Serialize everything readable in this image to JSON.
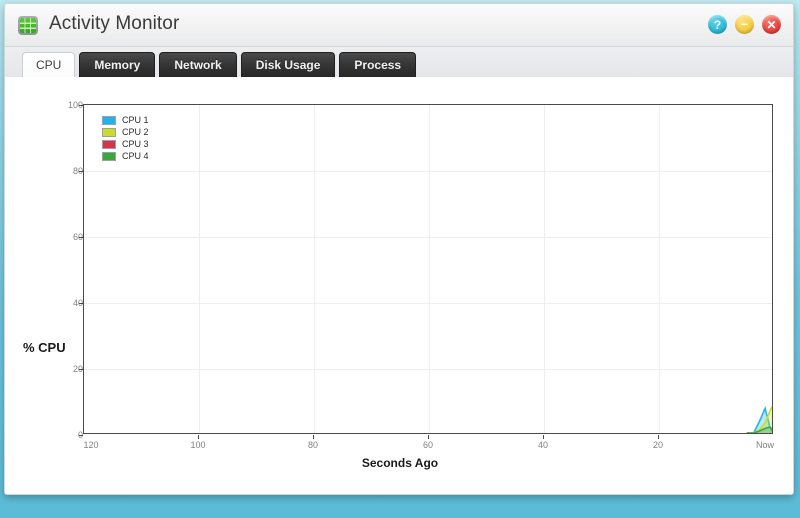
{
  "window": {
    "title": "Activity Monitor",
    "app_icon": "grid-monitor-icon",
    "controls": [
      {
        "name": "help-button",
        "icon": "question-icon",
        "glyph": "?",
        "color": "#2bbcd6"
      },
      {
        "name": "minimize-button",
        "icon": "minus-icon",
        "glyph": "–",
        "color": "#f5cd3e"
      },
      {
        "name": "close-button",
        "icon": "close-icon",
        "glyph": "✕",
        "color": "#e8453c"
      }
    ]
  },
  "tabs": [
    {
      "label": "CPU",
      "active": true
    },
    {
      "label": "Memory",
      "active": false
    },
    {
      "label": "Network",
      "active": false
    },
    {
      "label": "Disk Usage",
      "active": false
    },
    {
      "label": "Process",
      "active": false
    }
  ],
  "chart_data": {
    "type": "line",
    "title": "",
    "xlabel": "Seconds Ago",
    "ylabel": "% CPU",
    "xlim": [
      120,
      0
    ],
    "ylim": [
      0,
      100
    ],
    "grid": true,
    "legend_position": "top-left",
    "xticks": [
      {
        "value": 120,
        "label": "120"
      },
      {
        "value": 100,
        "label": "100"
      },
      {
        "value": 80,
        "label": "80"
      },
      {
        "value": 60,
        "label": "60"
      },
      {
        "value": 40,
        "label": "40"
      },
      {
        "value": 20,
        "label": "20"
      },
      {
        "value": 0,
        "label": "Now"
      }
    ],
    "yticks": [
      {
        "value": 0,
        "label": "0"
      },
      {
        "value": 20,
        "label": "20"
      },
      {
        "value": 40,
        "label": "40"
      },
      {
        "value": 60,
        "label": "60"
      },
      {
        "value": 80,
        "label": "80"
      },
      {
        "value": 100,
        "label": "100"
      }
    ],
    "series": [
      {
        "name": "CPU 1",
        "color": "#21b4ea",
        "x": [
          4.4,
          3.2,
          2.2,
          1.2,
          0.4,
          0.0
        ],
        "values": [
          0,
          0,
          3.5,
          7.5,
          2.0,
          0.5
        ]
      },
      {
        "name": "CPU 2",
        "color": "#cade27",
        "x": [
          4.4,
          3.2,
          2.2,
          1.2,
          0.4,
          0.0
        ],
        "values": [
          0,
          0,
          1.0,
          3.0,
          6.5,
          8.0
        ]
      },
      {
        "name": "CPU 3",
        "color": "#d5344a",
        "x": [
          4.4,
          3.2,
          2.2,
          1.2,
          0.4,
          0.0
        ],
        "values": [
          0,
          0,
          0,
          0,
          0,
          0
        ]
      },
      {
        "name": "CPU 4",
        "color": "#3aa83a",
        "x": [
          4.4,
          3.2,
          2.2,
          1.2,
          0.4,
          0.0
        ],
        "values": [
          0,
          0,
          0.6,
          1.4,
          1.8,
          1.2
        ]
      }
    ]
  }
}
